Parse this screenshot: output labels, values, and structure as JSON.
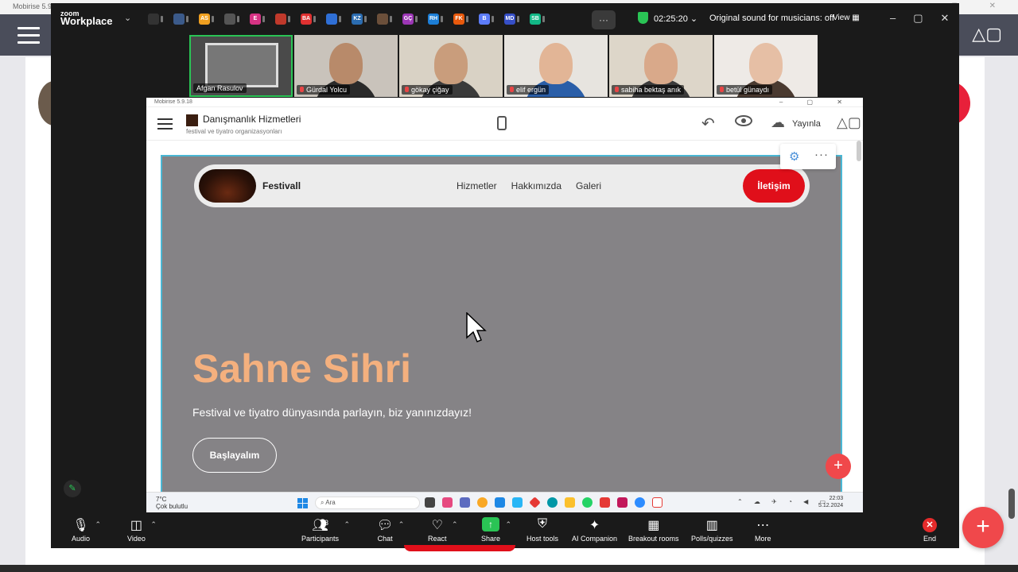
{
  "host": {
    "title": "Mobirise 5.9",
    "plus_label": "+"
  },
  "zoom": {
    "logo_top": "zoom",
    "logo_bottom": "Workplace",
    "participants_strip": [
      {
        "initial": "",
        "color": "#333333"
      },
      {
        "initial": "",
        "color": "#3b5a8a"
      },
      {
        "initial": "AS",
        "color": "#f0a020"
      },
      {
        "initial": "",
        "color": "#555555"
      },
      {
        "initial": "E",
        "color": "#d63384"
      },
      {
        "initial": "",
        "color": "#c0392b"
      },
      {
        "initial": "BA",
        "color": "#e03131"
      },
      {
        "initial": "",
        "color": "#2f6fd6"
      },
      {
        "initial": "KZ",
        "color": "#2b6cb0"
      },
      {
        "initial": "",
        "color": "#6b4f3a"
      },
      {
        "initial": "GÇ",
        "color": "#9c36b5"
      },
      {
        "initial": "RH",
        "color": "#1c7ed6"
      },
      {
        "initial": "FK",
        "color": "#e8590c"
      },
      {
        "initial": "B",
        "color": "#5c7cfa"
      },
      {
        "initial": "MD",
        "color": "#364fc7"
      },
      {
        "initial": "SB",
        "color": "#12b886"
      }
    ],
    "timer": "02:25:20",
    "sound_status": "Original sound for musicians: off",
    "view_label": "View",
    "videos": [
      {
        "name": "Afgan Rasulov",
        "active": true,
        "bg": "#4a4a4a",
        "skin": "#7a7a7a",
        "shirt": "#333333"
      },
      {
        "name": "Gürdal Yolcu",
        "active": false,
        "bg": "#c9c3bb",
        "skin": "#b88a6a",
        "shirt": "#2a2a2a"
      },
      {
        "name": "gökay çiğay",
        "active": false,
        "bg": "#d9d2c5",
        "skin": "#c99d7c",
        "shirt": "#3a3a3a"
      },
      {
        "name": "elif ergün",
        "active": false,
        "bg": "#e7e4df",
        "skin": "#e2b596",
        "shirt": "#2a5ea8"
      },
      {
        "name": "sabiha bektaş anık",
        "active": false,
        "bg": "#ddd6c9",
        "skin": "#d9a98a",
        "shirt": "#3b3b3b"
      },
      {
        "name": "betül günaydı",
        "active": false,
        "bg": "#eeeae6",
        "skin": "#e6bfa5",
        "shirt": "#4a3a30"
      }
    ],
    "toolbar": {
      "audio": "Audio",
      "video": "Video",
      "participants": "Participants",
      "participants_count": "23",
      "chat": "Chat",
      "react": "React",
      "share": "Share",
      "host_tools": "Host tools",
      "ai_companion": "AI Companion",
      "breakout_rooms": "Breakout rooms",
      "polls": "Polls/quizzes",
      "more": "More",
      "end": "End"
    }
  },
  "mobirise": {
    "window_title": "Mobirise 5.9.18",
    "project_name": "Danışmanlık Hizmetleri",
    "project_sub": "festival ve tiyatro organizasyonları",
    "publish_label": "Yayınla",
    "site": {
      "brand": "Festivall",
      "nav": [
        "Hizmetler",
        "Hakkımızda",
        "Galeri"
      ],
      "cta": "İletişim",
      "hero_title": "Sahne Sihri",
      "hero_subtitle": "Festival ve tiyatro dünyasında parlayın, biz yanınızdayız!",
      "hero_button": "Başlayalım"
    }
  },
  "windows_taskbar": {
    "temperature": "7°C",
    "weather": "Çok bulutlu",
    "search_placeholder": "Ara",
    "time": "22:03",
    "date": "5.12.2024"
  },
  "colors": {
    "hero_title": "#f4b07e",
    "cta_red": "#e00f1a",
    "canvas_bg": "#858386",
    "zoom_green": "#2ac455"
  }
}
